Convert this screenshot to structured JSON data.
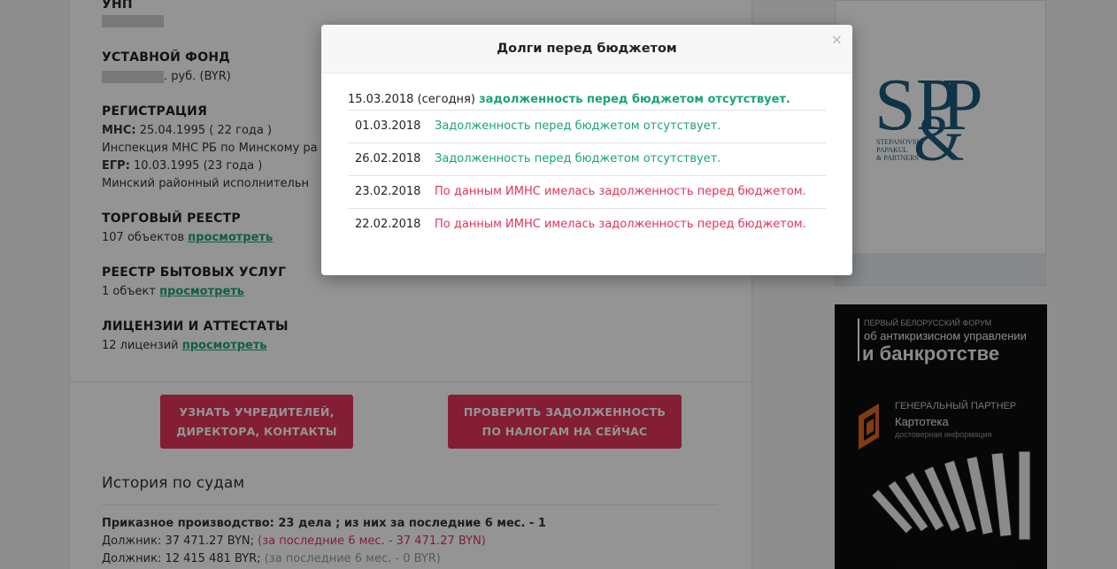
{
  "company": {
    "unp_label": "УНП",
    "fund_label": "УСТАВНОЙ ФОНД",
    "fund_suffix": ". руб. (BYR)",
    "reg_label": "РЕГИСТРАЦИЯ",
    "mns_label": "МНС:",
    "mns_value": " 25.04.1995 ( 22 года )",
    "mns_inspection": "Инспекция МНС РБ по Минскому ра",
    "egr_label": "ЕГР:",
    "egr_value": " 10.03.1995 (23 года )",
    "egr_body": "Минский районный исполнительн",
    "trade_label": "ТОРГОВЫЙ РЕЕСТР",
    "trade_count": "107 объектов ",
    "services_label": "РЕЕСТР БЫТОВЫХ УСЛУГ",
    "services_count": "1 объект ",
    "licenses_label": "ЛИЦЕНЗИИ И АТТЕСТАТЫ",
    "licenses_count": "12 лицензий ",
    "view_link": "просмотреть"
  },
  "buttons": {
    "founders": [
      "УЗНАТЬ УЧРЕДИТЕЛЕЙ,",
      "ДИРЕКТОРА, КОНТАКТЫ"
    ],
    "debt_check": [
      "ПРОВЕРИТЬ ЗАДОЛЖЕННОСТЬ",
      "ПО НАЛОГАМ НА СЕЙЧАС"
    ]
  },
  "courts": {
    "title": "История по судам",
    "summary": "Приказное производство: 23 дела ; из них за последние 6 мес. - 1",
    "debtor1": "Должник: 37 471.27 BYN;",
    "debtor1_recent": " (за последние 6 мес. - 37 471.27 BYN)",
    "debtor2": "Должник: 12 415 481 BYR;",
    "debtor2_recent": " (за последние 6 мес. - 0 BYR)"
  },
  "ads": {
    "spp_line1": "STEPANOVSKI",
    "spp_line2": "PAPAKUL",
    "spp_line3": "& PARTNERS",
    "forum_small": "ПЕРВЫЙ БЕЛОРУССКИЙ ФОРУМ",
    "forum_mid": "об антикризисном управлении",
    "forum_big": "и банкротстве",
    "partner_label": "ГЕНЕРАЛЬНЫЙ ПАРТНЕР",
    "partner_name": "Картотека",
    "partner_tag": "достоверная информация"
  },
  "modal": {
    "title": "Долги перед бюджетом",
    "close": "×",
    "today_date": "15.03.2018 (сегодня) ",
    "today_status": "задолженность перед бюджетом отсутствует.",
    "rows": [
      {
        "date": "01.03.2018",
        "status": "Задолженность перед бюджетом отсутствует."
      },
      {
        "date": "26.02.2018",
        "status": "Задолженность перед бюджетом отсутствует."
      },
      {
        "date": "23.02.2018",
        "status": "По данным ИМНС имелась задолженность перед бюджетом."
      },
      {
        "date": "22.02.2018",
        "status": "По данным ИМНС имелась задолженность перед бюджетом."
      }
    ]
  },
  "colors": {
    "ok_green": "#1aa37a",
    "debt_red": "#e2345a",
    "button_red": "#e2345a",
    "spp_teal": "#1d5a7a"
  }
}
